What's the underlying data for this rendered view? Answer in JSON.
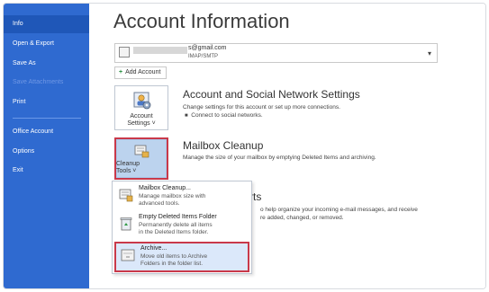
{
  "sidebar": {
    "items": [
      {
        "label": "Info"
      },
      {
        "label": "Open & Export"
      },
      {
        "label": "Save As"
      },
      {
        "label": "Save Attachments"
      },
      {
        "label": "Print"
      },
      {
        "label": "Office Account"
      },
      {
        "label": "Options"
      },
      {
        "label": "Exit"
      }
    ]
  },
  "main": {
    "title": "Account Information",
    "account": {
      "email": "s@gmail.com",
      "type": "IMAP/SMTP"
    },
    "add_account_label": "Add Account",
    "account_settings": {
      "button_line1": "Account",
      "button_line2": "Settings ˅",
      "title": "Account and Social Network Settings",
      "desc": "Change settings for this account or set up more connections.",
      "bullet": "Connect to social networks."
    },
    "mailbox_cleanup": {
      "button_line1": "Cleanup",
      "button_line2": "Tools ˅",
      "title": "Mailbox Cleanup",
      "desc": "Manage the size of your mailbox by emptying Deleted Items and archiving."
    },
    "rules_partial": {
      "title_fragment": "rts",
      "line1": "o help organize your incoming e-mail messages, and receive",
      "line2": "re added, changed, or removed."
    },
    "menu": {
      "items": [
        {
          "title": "Mailbox Cleanup...",
          "desc1": "Manage mailbox size with",
          "desc2": "advanced tools."
        },
        {
          "title": "Empty Deleted Items Folder",
          "desc1": "Permanently delete all items",
          "desc2": "in the Deleted Items folder."
        },
        {
          "title": "Archive...",
          "desc1": "Move old items to Archive",
          "desc2": "Folders in the folder list."
        }
      ]
    }
  },
  "colors": {
    "sidebar_bg": "#2f6ad0",
    "sidebar_active": "#1f57b8",
    "highlight_border": "#c9394a",
    "highlight_bg": "#dbe8fa"
  }
}
